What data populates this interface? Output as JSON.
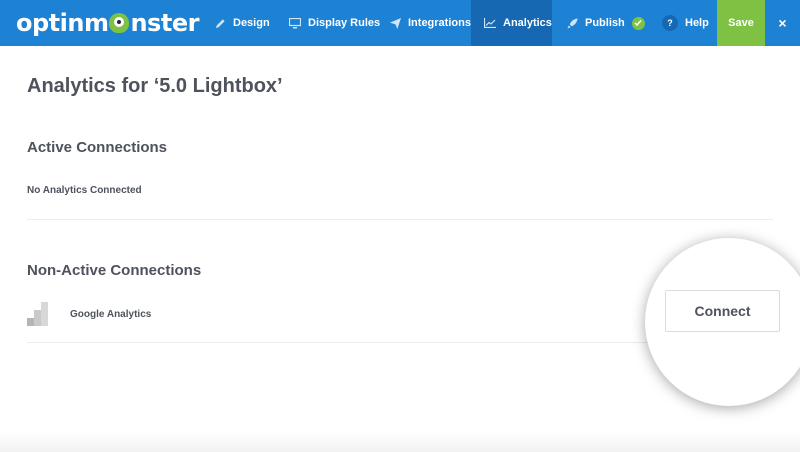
{
  "topbar": {
    "logo_pre": "optinm",
    "logo_post": "nster",
    "nav": [
      {
        "label": "Design",
        "icon": "pencil-icon"
      },
      {
        "label": "Display Rules",
        "icon": "monitor-icon"
      },
      {
        "label": "Integrations",
        "icon": "paper-plane-icon"
      },
      {
        "label": "Analytics",
        "icon": "chart-line-icon",
        "active": true
      },
      {
        "label": "Publish",
        "icon": "rocket-icon",
        "status": "check-icon"
      },
      {
        "label": "Help",
        "icon": "question-icon"
      }
    ],
    "help_glyph": "?",
    "save_label": "Save",
    "close_glyph": "×"
  },
  "main": {
    "title": "Analytics for ‘5.0 Lightbox’",
    "active": {
      "heading": "Active Connections",
      "empty_text": "No Analytics Connected"
    },
    "inactive": {
      "heading": "Non-Active Connections",
      "items": [
        {
          "name": "Google Analytics",
          "icon": "google-analytics-icon",
          "action_label": "Connect"
        }
      ]
    }
  },
  "colors": {
    "topbar": "#1e82d4",
    "topbar_active": "#1668b3",
    "save": "#7fc243",
    "text": "#4d525c"
  }
}
